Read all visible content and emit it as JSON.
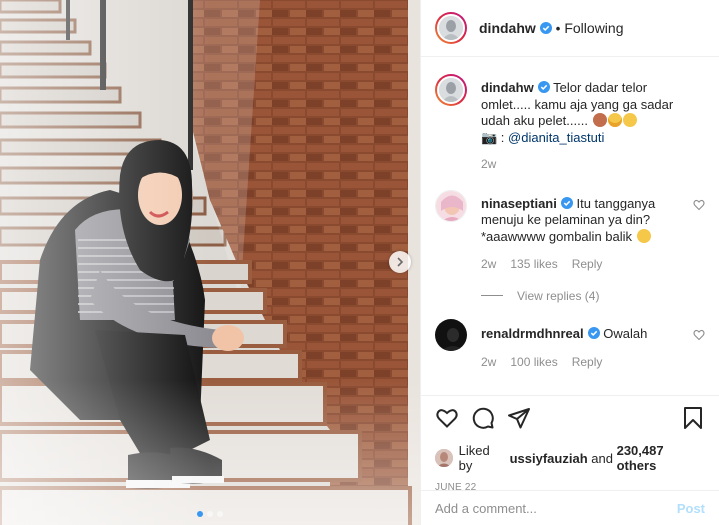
{
  "header": {
    "username": "dindahw",
    "separator": "•",
    "follow_status": "Following"
  },
  "caption": {
    "username": "dindahw",
    "text": "Telor dadar telor omlet..... kamu aja yang ga sadar udah aku pelet......",
    "emojis": [
      "woman-gesturing-no-emoji",
      "grimacing-emoji",
      "relieved-emoji"
    ],
    "camera_glyph": "📷",
    "credit_prefix": " : ",
    "credit_mention": "@dianita_tiastuti",
    "age": "2w"
  },
  "comments": [
    {
      "username": "ninaseptiani",
      "text": "Itu tangganya menuju ke pelaminan ya din? *aaawwww gombalin balik",
      "emoji": "rolling-laughing-emoji",
      "age": "2w",
      "likes": "135 likes",
      "reply": "Reply",
      "view_replies": "View replies (4)"
    },
    {
      "username": "renaldrmdhnreal",
      "text": "Owalah",
      "age": "2w",
      "likes": "100 likes",
      "reply": "Reply"
    }
  ],
  "likes": {
    "prefix": "Liked by ",
    "user": "ussiyfauziah",
    "middle": " and ",
    "others": "230,487 others"
  },
  "date": "JUNE 22",
  "comment_box": {
    "placeholder": "Add a comment...",
    "post_label": "Post"
  },
  "carousel": {
    "slides": 3,
    "active_index": 0
  },
  "colors": {
    "verified": "#3897f0",
    "link": "#00376b",
    "muted": "#8e8e8e",
    "post_disabled": "#b2dffc"
  }
}
